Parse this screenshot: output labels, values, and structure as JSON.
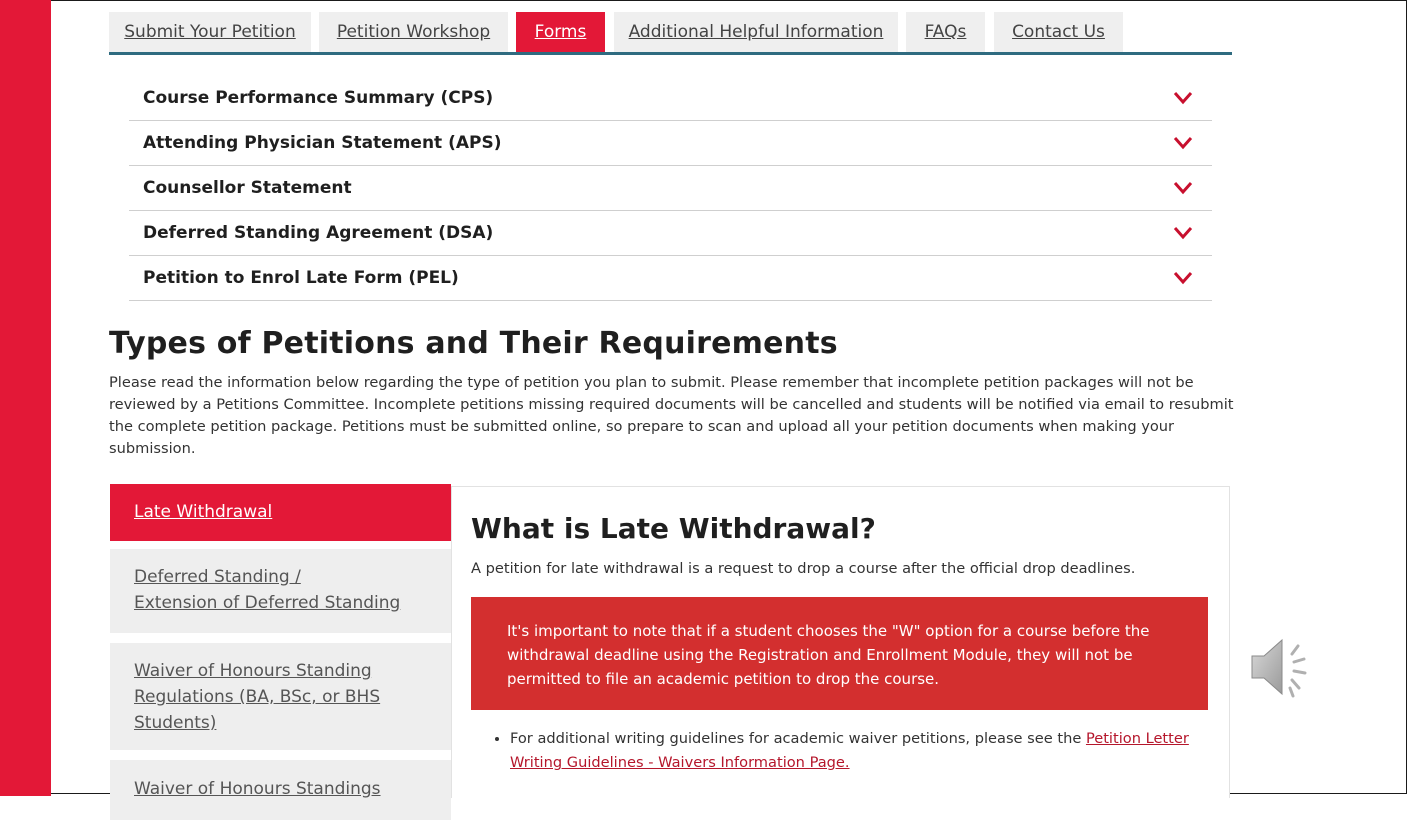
{
  "tabs": [
    {
      "label": "Submit Your Petition",
      "active": false
    },
    {
      "label": "Petition Workshop",
      "active": false
    },
    {
      "label": "Forms",
      "active": true
    },
    {
      "label": "Additional Helpful Information",
      "active": false
    },
    {
      "label": "FAQs",
      "active": false
    },
    {
      "label": "Contact Us",
      "active": false
    }
  ],
  "accordion": [
    {
      "label": "Course Performance Summary (CPS)",
      "icon": "chevron-down-icon"
    },
    {
      "label": "Attending Physician Statement (APS)",
      "icon": "chevron-down-icon"
    },
    {
      "label": "Counsellor Statement",
      "icon": "chevron-down-icon"
    },
    {
      "label": "Deferred Standing Agreement (DSA)",
      "icon": "chevron-down-icon"
    },
    {
      "label": "Petition to Enrol Late Form (PEL)",
      "icon": "chevron-down-icon"
    }
  ],
  "section": {
    "title": "Types of Petitions and Their Requirements",
    "intro": "Please read the information below regarding the type of petition you plan to submit. Please remember that incomplete petition packages will not be reviewed by a Petitions Committee. Incomplete petitions missing required documents will be cancelled and students will be notified via email to resubmit the complete petition package. Petitions must be submitted online, so prepare to scan and upload all your petition documents when making your submission."
  },
  "sidenav": [
    {
      "line1": "Late Withdrawal",
      "line2": "",
      "active": true
    },
    {
      "line1": "Deferred Standing /",
      "line2": "Extension of Deferred Standing",
      "active": false
    },
    {
      "line1": "Waiver of Honours Standing",
      "line2": "Regulations (BA, BSc, or BHS Students)",
      "active": false
    },
    {
      "line1": "Waiver of Honours Standings",
      "line2": "",
      "active": false
    }
  ],
  "content": {
    "title": "What is Late Withdrawal?",
    "description": "A petition for late withdrawal is a request to drop a course after the official drop deadlines.",
    "alert": "It's important to note that if a student chooses the \"W\" option for a course before the withdrawal deadline using the Registration and Enrollment Module, they will not be permitted to file an academic petition to drop the course.",
    "bullet_text": "For additional writing guidelines for academic waiver petitions, please see the ",
    "bullet_link": "Petition Letter Writing Guidelines - Waivers Information Page."
  },
  "colors": {
    "accent_red": "#e31837",
    "alert_red": "#d32f2f",
    "tab_underline": "#2f6b80"
  },
  "speaker_icon": "speaker-volume-icon"
}
